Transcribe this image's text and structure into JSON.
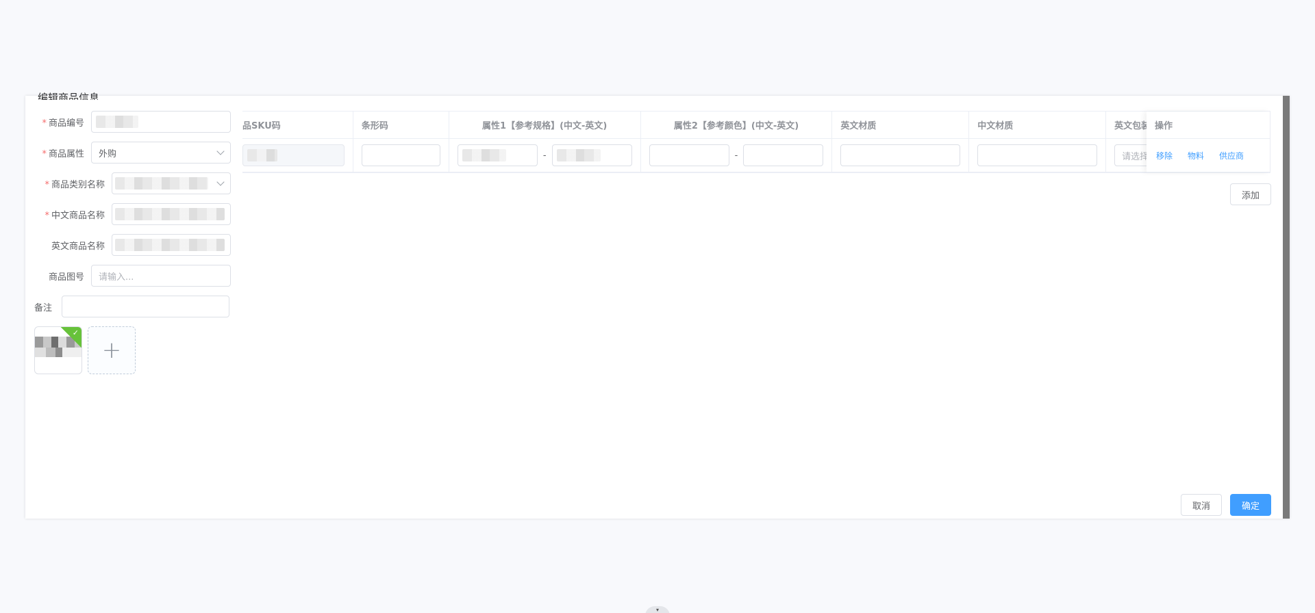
{
  "dialog": {
    "title": "编辑商品信息"
  },
  "form": {
    "product_code": {
      "label": "商品编号",
      "required": true,
      "value": ""
    },
    "product_attr": {
      "label": "商品属性",
      "required": true,
      "value": "外购"
    },
    "category": {
      "label": "商品类别名称",
      "required": true,
      "value": ""
    },
    "cn_name": {
      "label": "中文商品名称",
      "required": true,
      "value": ""
    },
    "en_name": {
      "label": "英文商品名称",
      "required": false,
      "value": ""
    },
    "drawing_no": {
      "label": "商品图号",
      "required": false,
      "placeholder": "请输入..."
    },
    "remark": {
      "label": "备注",
      "required": false,
      "value": ""
    }
  },
  "upload": {
    "add_symbol": "+",
    "uploaded_check": "✓"
  },
  "table": {
    "headers": {
      "sku": "品SKU码",
      "barcode": "条形码",
      "attr1": "属性1【参考规格】(中文-英文)",
      "attr2": "属性2【参考颜色】(中文-英文)",
      "en_material": "英文材质",
      "cn_material": "中文材质",
      "en_pack": "英文包装",
      "op": "操作"
    },
    "row": {
      "separator": "-",
      "en_pack_placeholder": "请选择",
      "actions": {
        "remove": "移除",
        "material": "物料",
        "supplier": "供应商"
      }
    },
    "add_label": "添加"
  },
  "footer": {
    "cancel": "取消",
    "confirm": "确定"
  },
  "drawer_tab": "▾",
  "colors": {
    "primary": "#409eff",
    "required": "#f56c6c",
    "success": "#67c23a"
  }
}
